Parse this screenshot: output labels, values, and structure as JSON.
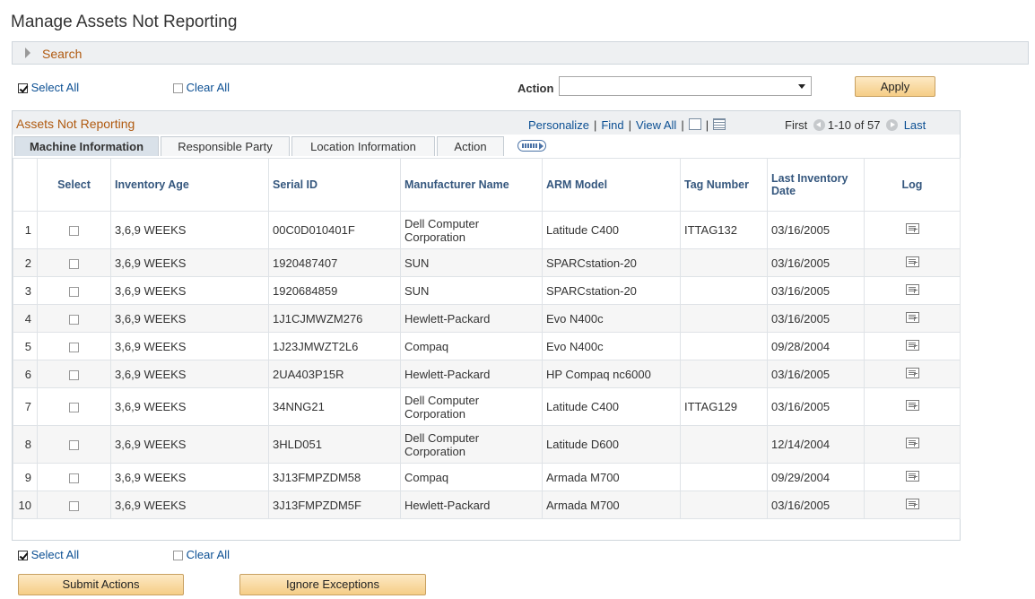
{
  "page": {
    "title": "Manage Assets Not Reporting"
  },
  "search": {
    "label": "Search"
  },
  "top_controls": {
    "select_all": "Select All",
    "clear_all": "Clear All",
    "action_label": "Action",
    "action_value": "",
    "apply": "Apply"
  },
  "grid": {
    "title": "Assets Not Reporting",
    "tools": {
      "personalize": "Personalize",
      "find": "Find",
      "view_all": "View All"
    },
    "pager": {
      "first": "First",
      "range": "1-10 of 57",
      "last": "Last"
    },
    "tabs": [
      {
        "label": "Machine Information",
        "active": true
      },
      {
        "label": "Responsible Party",
        "active": false
      },
      {
        "label": "Location Information",
        "active": false
      },
      {
        "label": "Action",
        "active": false
      }
    ],
    "columns": [
      "Select",
      "Inventory Age",
      "Serial ID",
      "Manufacturer Name",
      "ARM Model",
      "Tag Number",
      "Last Inventory Date",
      "Log"
    ],
    "rows": [
      {
        "num": "1",
        "age": "3,6,9 WEEKS",
        "serial": "00C0D010401F",
        "mfr": "Dell Computer Corporation",
        "model": "Latitude C400",
        "tag": "ITTAG132",
        "date": "03/16/2005"
      },
      {
        "num": "2",
        "age": "3,6,9 WEEKS",
        "serial": "1920487407",
        "mfr": "SUN",
        "model": "SPARCstation-20",
        "tag": "",
        "date": "03/16/2005"
      },
      {
        "num": "3",
        "age": "3,6,9 WEEKS",
        "serial": "1920684859",
        "mfr": "SUN",
        "model": "SPARCstation-20",
        "tag": "",
        "date": "03/16/2005"
      },
      {
        "num": "4",
        "age": "3,6,9 WEEKS",
        "serial": "1J1CJMWZM276",
        "mfr": "Hewlett-Packard",
        "model": "Evo N400c",
        "tag": "",
        "date": "03/16/2005"
      },
      {
        "num": "5",
        "age": "3,6,9 WEEKS",
        "serial": "1J23JMWZT2L6",
        "mfr": "Compaq",
        "model": "Evo N400c",
        "tag": "",
        "date": "09/28/2004"
      },
      {
        "num": "6",
        "age": "3,6,9 WEEKS",
        "serial": "2UA403P15R",
        "mfr": "Hewlett-Packard",
        "model": "HP Compaq nc6000",
        "tag": "",
        "date": "03/16/2005"
      },
      {
        "num": "7",
        "age": "3,6,9 WEEKS",
        "serial": "34NNG21",
        "mfr": "Dell Computer Corporation",
        "model": "Latitude C400",
        "tag": "ITTAG129",
        "date": "03/16/2005"
      },
      {
        "num": "8",
        "age": "3,6,9 WEEKS",
        "serial": "3HLD051",
        "mfr": "Dell Computer Corporation",
        "model": "Latitude D600",
        "tag": "",
        "date": "12/14/2004"
      },
      {
        "num": "9",
        "age": "3,6,9 WEEKS",
        "serial": "3J13FMPZDM58",
        "mfr": "Compaq",
        "model": "Armada M700",
        "tag": "",
        "date": "09/29/2004"
      },
      {
        "num": "10",
        "age": "3,6,9 WEEKS",
        "serial": "3J13FMPZDM5F",
        "mfr": "Hewlett-Packard",
        "model": "Armada M700",
        "tag": "",
        "date": "03/16/2005"
      }
    ]
  },
  "bottom_controls": {
    "select_all": "Select All",
    "clear_all": "Clear All",
    "submit_actions": "Submit Actions",
    "ignore_exceptions": "Ignore Exceptions"
  },
  "icons": {
    "expand": "triangle-right-icon",
    "checkbox_checked": "checkbox-checked-icon",
    "checkbox_unchecked": "checkbox-icon",
    "new_window": "new-window-icon",
    "download": "grid-download-icon",
    "prev": "prev-circle-icon",
    "next": "next-circle-icon",
    "show_all_columns": "show-all-columns-icon",
    "log": "log-icon"
  },
  "colors": {
    "header_link": "#0b4f93",
    "section_title": "#b05a10",
    "column_header": "#35577e"
  }
}
